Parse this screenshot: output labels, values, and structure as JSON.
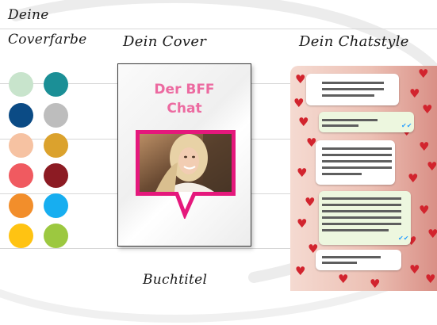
{
  "labels": {
    "deine": "Deine",
    "coverfarbe": "Coverfarbe",
    "cover": "Dein Cover",
    "chatstyle": "Dein Chatstyle",
    "buchtitel": "Buchtitel"
  },
  "cover": {
    "title_line1": "Der BFF",
    "title_line2": "Chat",
    "title_color": "#ec6aa0",
    "frame_color": "#e5187c"
  },
  "swatches": [
    {
      "name": "mint",
      "color": "#c8e4cc"
    },
    {
      "name": "teal",
      "color": "#1b8f96"
    },
    {
      "name": "navy",
      "color": "#0b4b85"
    },
    {
      "name": "gray",
      "color": "#bdbdbd"
    },
    {
      "name": "peach",
      "color": "#f6c2a2"
    },
    {
      "name": "mustard",
      "color": "#dba22d"
    },
    {
      "name": "coral",
      "color": "#f05a60"
    },
    {
      "name": "burgundy",
      "color": "#8c1b23"
    },
    {
      "name": "orange",
      "color": "#f28e2b"
    },
    {
      "name": "sky-blue",
      "color": "#17aef0"
    },
    {
      "name": "yellow",
      "color": "#ffc312"
    },
    {
      "name": "lime",
      "color": "#9cc840"
    }
  ],
  "chat_style": {
    "background": "#ecc0b4",
    "heart_color": "#d2242e",
    "incoming_bubble": "#ffffff",
    "outgoing_bubble": "#edf7df",
    "read_receipt_color": "#2aa0ff",
    "icons": [
      "heart-icon",
      "double-check-icon"
    ]
  }
}
